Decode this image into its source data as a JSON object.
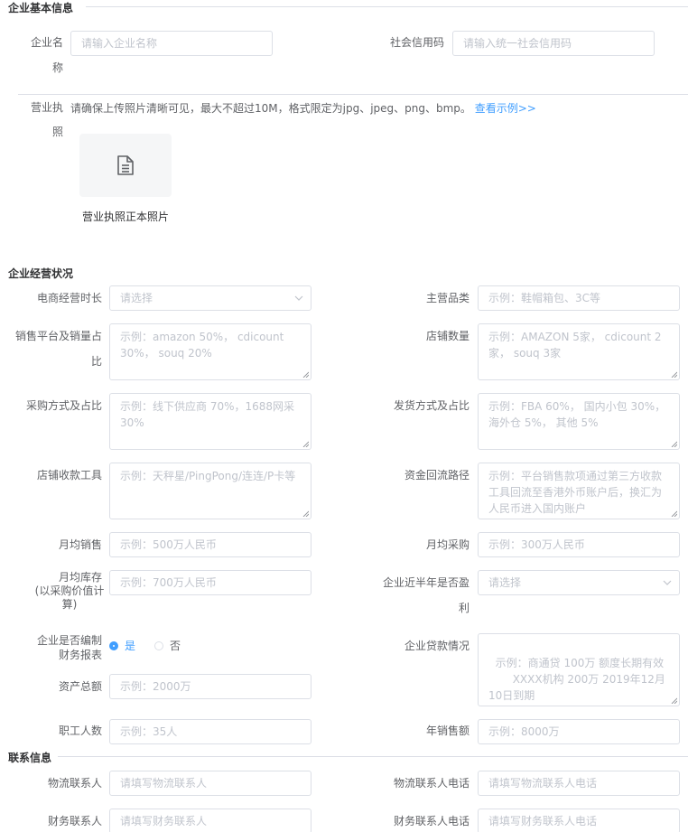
{
  "sections": {
    "basic": "企业基本信息",
    "business": "企业经营状况",
    "contact": "联系信息"
  },
  "basic": {
    "company_name_label_1": "企业名",
    "company_name_label_2": "称",
    "company_name_placeholder": "请输入企业名称",
    "credit_code_label": "社会信用码",
    "credit_code_placeholder": "请输入统一社会信用码",
    "license_label_1": "营业执",
    "license_label_2": "照",
    "license_hint": "请确保上传照片清晰可见，最大不超过10M，格式限定为jpg、jpeg、png、bmp。",
    "license_example_link": "查看示例>>",
    "license_upload_caption": "营业执照正本照片"
  },
  "business": {
    "ecommerce_duration_label": "电商经营时长",
    "ecommerce_duration_placeholder": "请选择",
    "main_category_label": "主营品类",
    "main_category_placeholder": "示例：鞋帽箱包、3C等",
    "platform_share_label_1": "销售平台及销量占",
    "platform_share_label_2": "比",
    "platform_share_placeholder": "示例：amazon 50%， cdicount 30%， souq 20%",
    "store_count_label": "店铺数量",
    "store_count_placeholder": "示例：AMAZON 5家， cdicount 2家， souq 3家",
    "purchase_method_label": "采购方式及占比",
    "purchase_method_placeholder": "示例：线下供应商 70%，1688网采 30%",
    "shipping_method_label": "发货方式及占比",
    "shipping_method_placeholder": "示例：FBA 60%， 国内小包 30%， 海外仓 5%， 其他 5%",
    "payment_tool_label": "店铺收款工具",
    "payment_tool_placeholder": "示例：天秤星/PingPong/连连/P卡等",
    "fund_path_label": "资金回流路径",
    "fund_path_placeholder": "示例：平台销售款项通过第三方收款工具回流至香港外币账户后，换汇为人民币进入国内账户",
    "monthly_sales_label": "月均销售",
    "monthly_sales_placeholder": "示例：500万人民币",
    "monthly_purchase_label": "月均采购",
    "monthly_purchase_placeholder": "示例：300万人民币",
    "monthly_inventory_label_1": "月均库存",
    "monthly_inventory_label_2": "(以采购价值计",
    "monthly_inventory_label_3": "算)",
    "monthly_inventory_placeholder": "示例：700万人民币",
    "profit_label_1": "企业近半年是否盈",
    "profit_label_2": "利",
    "profit_placeholder": "请选择",
    "financial_report_label_1": "企业是否编制",
    "financial_report_label_2": "财务报表",
    "financial_report_yes": "是",
    "financial_report_no": "否",
    "loan_label": "企业贷款情况",
    "loan_placeholder": "示例：商通贷 100万 额度长期有效\n       XXXX机构 200万 2019年12月10日到期",
    "total_assets_label": "资产总额",
    "total_assets_placeholder": "示例：2000万",
    "employees_label": "职工人数",
    "employees_placeholder": "示例：35人",
    "annual_sales_label": "年销售额",
    "annual_sales_placeholder": "示例：8000万"
  },
  "contact": {
    "logistics_contact_label": "物流联系人",
    "logistics_contact_placeholder": "请填写物流联系人",
    "logistics_phone_label": "物流联系人电话",
    "logistics_phone_placeholder": "请填写物流联系人电话",
    "finance_contact_label": "财务联系人",
    "finance_contact_placeholder": "请填写财务联系人",
    "finance_phone_label": "财务联系人电话",
    "finance_phone_placeholder": "请填写财务联系人电话"
  },
  "icons": {
    "document": "document-icon",
    "chevron": "chevron-down-icon"
  },
  "colors": {
    "accent": "#409eff",
    "border": "#dcdfe6",
    "placeholder": "#c0c4cc",
    "label": "#606266"
  }
}
